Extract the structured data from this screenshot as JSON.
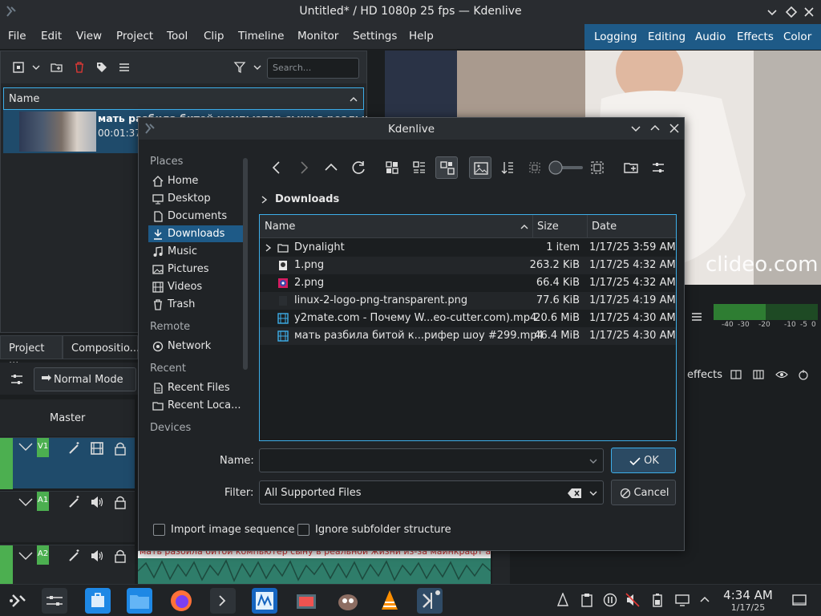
{
  "window": {
    "title": "Untitled* / HD 1080p 25 fps — Kdenlive"
  },
  "menu": [
    "File",
    "Edit",
    "View",
    "Project",
    "Tool",
    "Clip",
    "Timeline",
    "Monitor",
    "Settings",
    "Help"
  ],
  "layouts": [
    "Logging",
    "Editing",
    "Audio",
    "Effects",
    "Color"
  ],
  "bin": {
    "search_placeholder": "Search...",
    "header": "Name",
    "clip_name": "мать разбила битой компьютер сыну в реальной",
    "clip_duration": "00:01:37"
  },
  "dock_tabs": [
    "Project ...",
    "Compositio..."
  ],
  "monitor": {
    "watermark": "clideo.com",
    "meter_scale": [
      "-40",
      "-30",
      "-20",
      "-10",
      "-5",
      "0"
    ]
  },
  "timeline": {
    "mode": "Normal Mode",
    "master": "Master",
    "tracks": [
      "V1",
      "A1",
      "A2"
    ],
    "audio_clip_title": "мать разбила битой компьютер сыну в реальной жизни из-за майнкрафт анти-р",
    "effects_label": "effects"
  },
  "dialog": {
    "title": "Kdenlive",
    "places_sections": {
      "places": "Places",
      "remote": "Remote",
      "recent": "Recent",
      "devices": "Devices"
    },
    "places": [
      "Home",
      "Desktop",
      "Documents",
      "Downloads",
      "Music",
      "Pictures",
      "Videos",
      "Trash"
    ],
    "remote": [
      "Network"
    ],
    "recent": [
      "Recent Files",
      "Recent Loca..."
    ],
    "breadcrumb": "Downloads",
    "columns": {
      "name": "Name",
      "size": "Size",
      "date": "Date"
    },
    "files": [
      {
        "name": "Dynalight",
        "size": "1 item",
        "date": "1/17/25 3:59 AM",
        "icon": "folder-icon"
      },
      {
        "name": "1.png",
        "size": "263.2 KiB",
        "date": "1/17/25 4:32 AM",
        "icon": "image-icon"
      },
      {
        "name": "2.png",
        "size": "66.4 KiB",
        "date": "1/17/25 4:32 AM",
        "icon": "image-icon"
      },
      {
        "name": "linux-2-logo-png-transparent.png",
        "size": "77.6 KiB",
        "date": "1/17/25 4:19 AM",
        "icon": "image-icon"
      },
      {
        "name": "y2mate.com - Почему W...eo-cutter.com).mp4",
        "size": "20.6 MiB",
        "date": "1/17/25 4:30 AM",
        "icon": "video-icon"
      },
      {
        "name": "мать разбила битой к...рифер шоу #299.mp4",
        "size": "46.4 MiB",
        "date": "1/17/25 4:30 AM",
        "icon": "video-icon"
      }
    ],
    "name_label": "Name:",
    "name_value": "",
    "filter_label": "Filter:",
    "filter_value": "All Supported Files",
    "ok": "OK",
    "cancel": "Cancel",
    "import_sequence": "Import image sequence",
    "ignore_subfolder": "Ignore subfolder structure"
  },
  "taskbar": {
    "time": "4:34 AM",
    "date": "1/17/25"
  },
  "colors": {
    "accent": "#3daee9",
    "selection": "#1e5a87",
    "track_green": "#4caf50"
  }
}
